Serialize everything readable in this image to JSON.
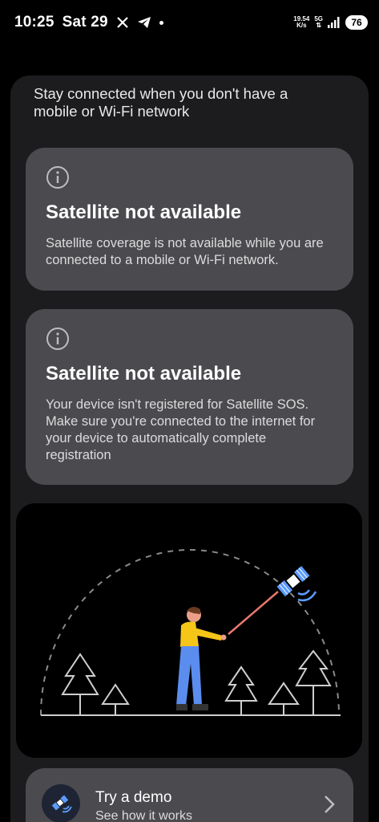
{
  "status_bar": {
    "time": "10:25",
    "date": "Sat 29",
    "speed_value": "19.54",
    "speed_unit": "K/s",
    "network": "5G",
    "battery": "76"
  },
  "intro_text": "Stay connected when you don't have a mobile or Wi-Fi network",
  "cards": [
    {
      "icon": "info-icon",
      "title": "Satellite not available",
      "body": "Satellite coverage is not available while you are connected to a mobile or Wi-Fi network."
    },
    {
      "icon": "info-icon",
      "title": "Satellite not available",
      "body": "Your device isn't registered for Satellite SOS. Make sure you're connected to the internet for your device to automatically complete registration"
    }
  ],
  "demo": {
    "icon": "satellite-icon",
    "title": "Try a demo",
    "subtitle": "See how it works"
  },
  "colors": {
    "panel_bg": "#1c1c1e",
    "card_bg": "#4b4a4f",
    "accent_blue": "#5b9bff",
    "figure_shirt": "#f5c518",
    "figure_pants": "#5b8def"
  }
}
